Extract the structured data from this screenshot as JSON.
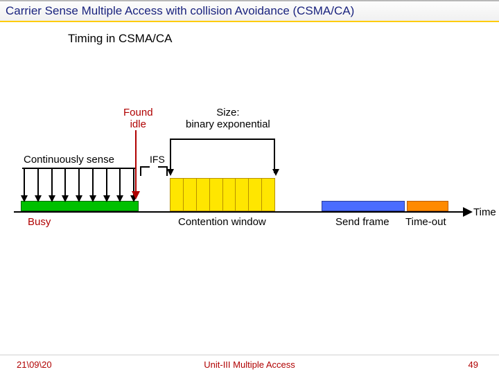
{
  "title": "Carrier Sense Multiple Access with collision Avoidance  (CSMA/CA)",
  "subtitle": "Timing in CSMA/CA",
  "labels": {
    "found_idle": "Found\nidle",
    "continuously_sense": "Continuously sense",
    "ifs": "IFS",
    "size": "Size:\nbinary exponential",
    "busy": "Busy",
    "contention_window": "Contention window",
    "send_frame": "Send frame",
    "timeout": "Time-out",
    "time": "Time"
  },
  "footer": {
    "date": "21\\09\\20",
    "middle": "Unit-III Multiple Access",
    "page": "49"
  },
  "contention_slots": 8
}
